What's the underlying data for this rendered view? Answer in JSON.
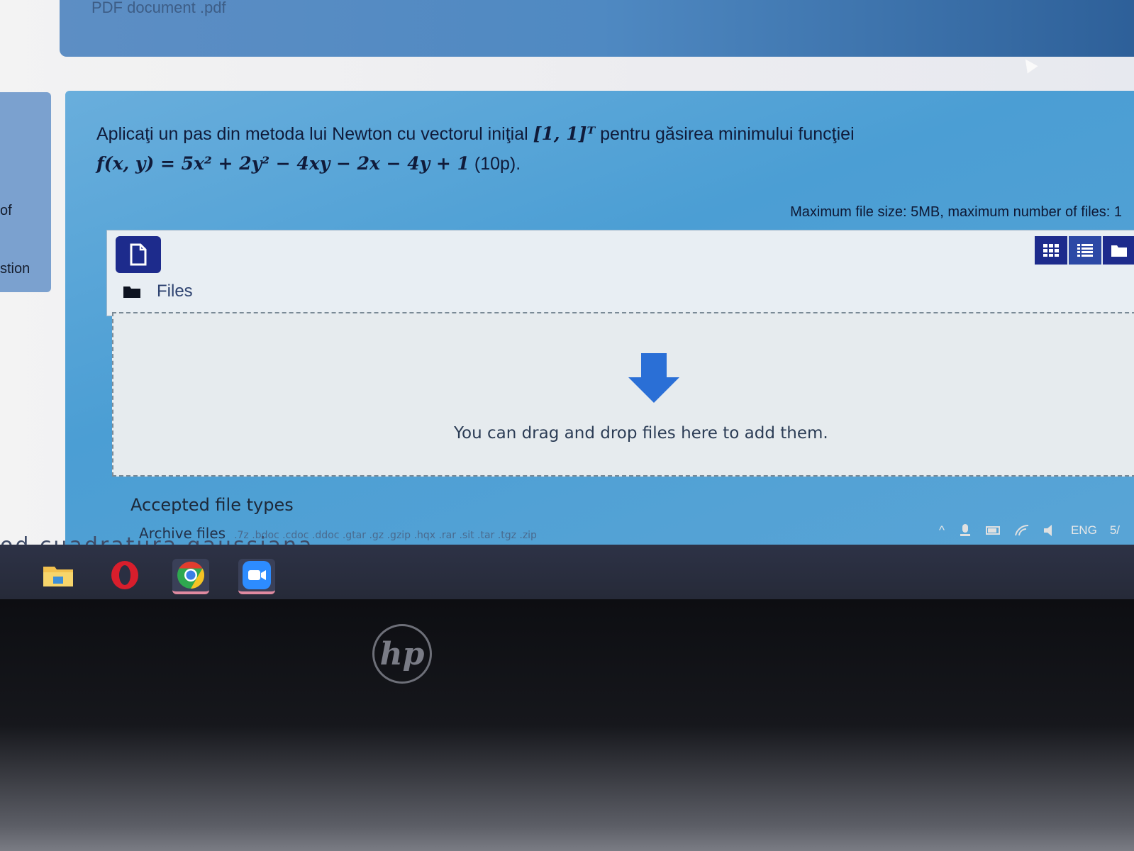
{
  "top_card": {
    "title": "PDF document .pdf"
  },
  "left_nav": {
    "items": [
      "of",
      "stion"
    ]
  },
  "question": {
    "text_before": "Aplicaţi un pas din metoda lui Newton cu vectorul iniţial ",
    "vector": "[1, 1]ᵀ",
    "text_after": " pentru găsirea minimului funcţiei",
    "formula": "f(x, y) = 5x² + 2y² − 4xy − 2x − 4y + 1",
    "points": " (10p)."
  },
  "filepicker": {
    "max_size_text": "Maximum file size: 5MB, maximum number of files: 1",
    "folder_label": "Files",
    "drop_text": "You can drag and drop files here to add them."
  },
  "accepted": {
    "title": "Accepted file types",
    "archive_label": "Archive files",
    "archive_exts": ".7z .bdoc .cdoc .ddoc .gtar .gz .gzip .hqx .rar .sit .tar .tgz .zip"
  },
  "behind_text": "od cuadratura gaussiana",
  "taskbar": {
    "apps": [
      "file-explorer",
      "opera",
      "chrome",
      "zoom"
    ],
    "tray_lang": "ENG",
    "clock_fragment": "5/"
  },
  "laptop": {
    "brand": "hp"
  }
}
